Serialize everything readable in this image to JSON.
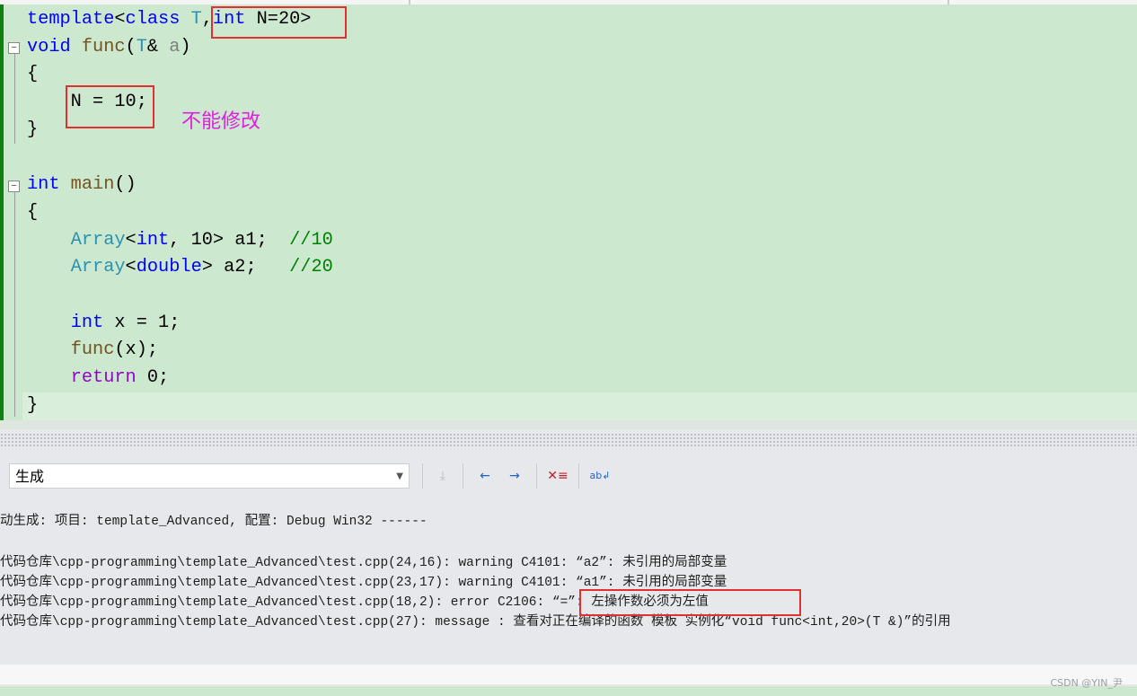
{
  "editor": {
    "lines": [
      [
        [
          "template",
          "#0000ff"
        ],
        [
          "<",
          "#000"
        ],
        [
          "class",
          "#0000ff"
        ],
        [
          " T",
          "#2b91af"
        ],
        [
          ",",
          "#000"
        ],
        [
          "int",
          "#0000ff"
        ],
        [
          " N=20>",
          "#000"
        ]
      ],
      [
        [
          "void",
          "#0000ff"
        ],
        [
          " func",
          "#74531f"
        ],
        [
          "(",
          "#000"
        ],
        [
          "T",
          "#2b91af"
        ],
        [
          "& ",
          "#000"
        ],
        [
          "a",
          "#808080"
        ],
        [
          ")",
          "#000"
        ]
      ],
      [
        [
          "{",
          "#000"
        ]
      ],
      [
        [
          "    N = 10;",
          "#000"
        ]
      ],
      [
        [
          "}",
          "#000"
        ]
      ],
      [],
      [
        [
          "int",
          "#0000ff"
        ],
        [
          " main",
          "#74531f"
        ],
        [
          "()",
          "#000"
        ]
      ],
      [
        [
          "{",
          "#000"
        ]
      ],
      [
        [
          "    ",
          "#000"
        ],
        [
          "Array",
          "#2b91af"
        ],
        [
          "<",
          "#000"
        ],
        [
          "int",
          "#0000ff"
        ],
        [
          ", 10> ",
          "#000"
        ],
        [
          "a1",
          "#000"
        ],
        [
          ";  ",
          "#000"
        ],
        [
          "//10",
          "#008000"
        ]
      ],
      [
        [
          "    ",
          "#000"
        ],
        [
          "Array",
          "#2b91af"
        ],
        [
          "<",
          "#000"
        ],
        [
          "double",
          "#0000ff"
        ],
        [
          "> ",
          "#000"
        ],
        [
          "a2",
          "#000"
        ],
        [
          ";   ",
          "#000"
        ],
        [
          "//20",
          "#008000"
        ]
      ],
      [],
      [
        [
          "    ",
          "#000"
        ],
        [
          "int",
          "#0000ff"
        ],
        [
          " x = 1;",
          "#000"
        ]
      ],
      [
        [
          "    ",
          "#000"
        ],
        [
          "func",
          "#74531f"
        ],
        [
          "(x);",
          "#000"
        ]
      ],
      [
        [
          "    ",
          "#000"
        ],
        [
          "return",
          "#8f08c4"
        ],
        [
          " 0;",
          "#000"
        ]
      ],
      [
        [
          "}",
          "#000"
        ]
      ]
    ],
    "annotation": "不能修改"
  },
  "output": {
    "source_select": "生成",
    "toolbar_icons": [
      "go-to-line-icon",
      "previous-message-icon",
      "next-message-icon",
      "clear-all-icon",
      "word-wrap-icon"
    ],
    "lines": [
      "动生成: 项目: template_Advanced, 配置: Debug Win32 ------",
      "",
      "代码仓库\\cpp-programming\\template_Advanced\\test.cpp(24,16): warning C4101: “a2”: 未引用的局部变量",
      "代码仓库\\cpp-programming\\template_Advanced\\test.cpp(23,17): warning C4101: “a1”: 未引用的局部变量",
      "代码仓库\\cpp-programming\\template_Advanced\\test.cpp(18,2): error C2106: “=”: 左操作数必须为左值",
      "代码仓库\\cpp-programming\\template_Advanced\\test.cpp(27): message : 查看对正在编译的函数 模板 实例化“void func<int,20>(T &)”的引用"
    ]
  },
  "watermark": "CSDN @YIN_尹"
}
